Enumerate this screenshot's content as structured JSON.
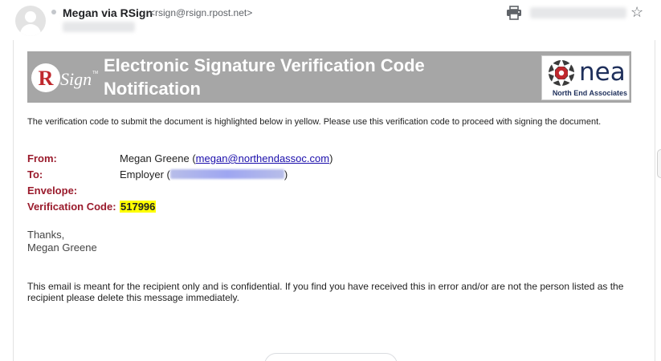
{
  "header": {
    "sender_name": "Megan via RSign",
    "sender_email": "<rsign@rsign.rpost.net>",
    "print_icon": "printer-icon",
    "star_icon": "star-icon",
    "avatar_icon": "person-avatar-icon"
  },
  "banner": {
    "rsign_logo": {
      "letter": "R",
      "word": "Sign",
      "tm": "TM"
    },
    "title": "Electronic Signature Verification Code Notification",
    "nea_logo": {
      "word": "nea",
      "subtitle": "North End Associates"
    },
    "colors": {
      "background": "#a6a6a6",
      "title": "#ffffff"
    }
  },
  "body": {
    "intro": "The verification code to submit the document is highlighted below in yellow. Please use this verification code to proceed with signing the document.",
    "fields": {
      "from_label": "From:",
      "from_name": "Megan Greene (",
      "from_email": "megan@northendassoc.com",
      "from_close": ")",
      "to_label": "To:",
      "to_name": "Employer (",
      "to_close": ")",
      "envelope_label": "Envelope:",
      "code_label": "Verification Code:",
      "code_value": "517996"
    },
    "signoff": "Thanks,",
    "signer": "Megan Greene",
    "notice": "This email is meant for the recipient only and is confidential. If you find you have received this in error and/or are not the person listed as the recipient please delete this message immediately."
  },
  "colors": {
    "label": "#9a1b2c",
    "link": "#1a0dab",
    "highlight": "#ffff00"
  }
}
